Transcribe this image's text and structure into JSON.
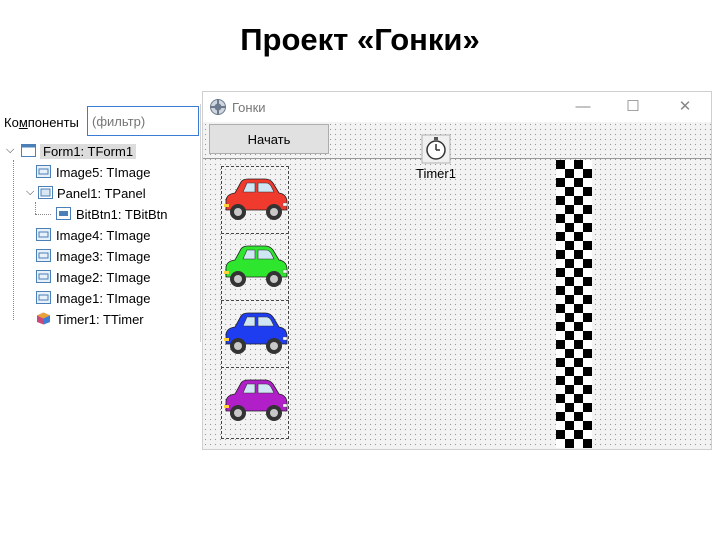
{
  "slide": {
    "title": "Проект «Гонки»"
  },
  "components_panel": {
    "filter_label_pre": "Ко",
    "filter_label_u": "м",
    "filter_label_post": "поненты",
    "filter_placeholder": "(фильтр)",
    "nodes": [
      {
        "label": "Form1: TForm1",
        "kind": "form",
        "selected": true
      },
      {
        "label": "Image5: TImage",
        "kind": "image"
      },
      {
        "label": "Panel1: TPanel",
        "kind": "panel"
      },
      {
        "label": "BitBtn1: TBitBtn",
        "kind": "bitbtn"
      },
      {
        "label": "Image4: TImage",
        "kind": "image"
      },
      {
        "label": "Image3: TImage",
        "kind": "image"
      },
      {
        "label": "Image2: TImage",
        "kind": "image"
      },
      {
        "label": "Image1: TImage",
        "kind": "image"
      },
      {
        "label": "Timer1: TTimer",
        "kind": "timer"
      }
    ]
  },
  "window": {
    "title": "Гонки",
    "minimize": "—",
    "maximize": "☐",
    "close": "✕",
    "start_button": "Начать",
    "timer_label": "Timer1",
    "cars": [
      {
        "color": "#f03a2e",
        "icon": "red-car"
      },
      {
        "color": "#2ee62e",
        "icon": "green-car"
      },
      {
        "color": "#1f3df0",
        "icon": "blue-car"
      },
      {
        "color": "#b01fc8",
        "icon": "purple-car"
      }
    ]
  }
}
